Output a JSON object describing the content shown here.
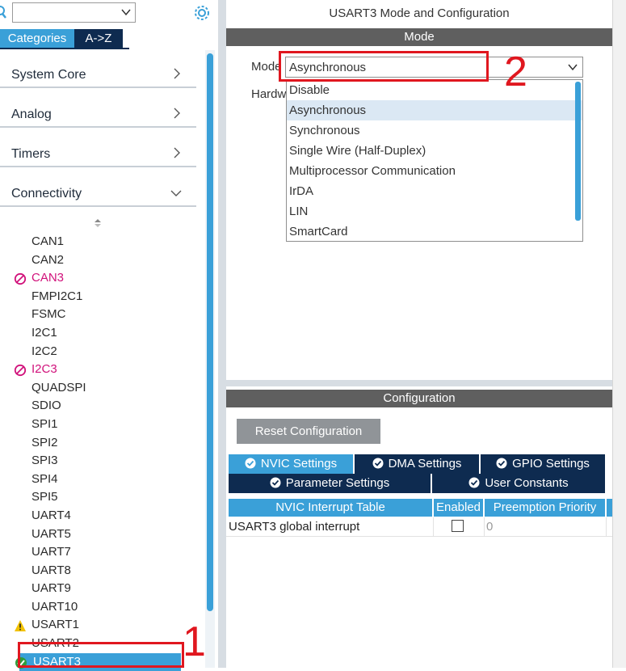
{
  "left_panel": {
    "tabs": [
      {
        "label": "Categories"
      },
      {
        "label": "A->Z"
      }
    ],
    "categories": [
      {
        "label": "System Core",
        "state": "collapsed"
      },
      {
        "label": "Analog",
        "state": "collapsed"
      },
      {
        "label": "Timers",
        "state": "collapsed"
      },
      {
        "label": "Connectivity",
        "state": "expanded"
      }
    ],
    "peripherals": [
      {
        "label": "CAN1",
        "status": "none"
      },
      {
        "label": "CAN2",
        "status": "none"
      },
      {
        "label": "CAN3",
        "status": "unavailable"
      },
      {
        "label": "FMPI2C1",
        "status": "none"
      },
      {
        "label": "FSMC",
        "status": "none"
      },
      {
        "label": "I2C1",
        "status": "none"
      },
      {
        "label": "I2C2",
        "status": "none"
      },
      {
        "label": "I2C3",
        "status": "unavailable"
      },
      {
        "label": "QUADSPI",
        "status": "none"
      },
      {
        "label": "SDIO",
        "status": "none"
      },
      {
        "label": "SPI1",
        "status": "none"
      },
      {
        "label": "SPI2",
        "status": "none"
      },
      {
        "label": "SPI3",
        "status": "none"
      },
      {
        "label": "SPI4",
        "status": "none"
      },
      {
        "label": "SPI5",
        "status": "none"
      },
      {
        "label": "UART4",
        "status": "none"
      },
      {
        "label": "UART5",
        "status": "none"
      },
      {
        "label": "UART7",
        "status": "none"
      },
      {
        "label": "UART8",
        "status": "none"
      },
      {
        "label": "UART9",
        "status": "none"
      },
      {
        "label": "UART10",
        "status": "none"
      },
      {
        "label": "USART1",
        "status": "warning"
      },
      {
        "label": "USART2",
        "status": "none"
      },
      {
        "label": "USART3",
        "status": "configured",
        "selected": true
      }
    ]
  },
  "right_panel": {
    "title": "USART3 Mode and Configuration",
    "mode_section": {
      "header": "Mode",
      "mode_label": "Mode",
      "mode_value": "Asynchronous",
      "hardware_label": "Hardw",
      "dropdown_options": [
        "Disable",
        "Asynchronous",
        "Synchronous",
        "Single Wire (Half-Duplex)",
        "Multiprocessor Communication",
        "IrDA",
        "LIN",
        "SmartCard"
      ],
      "highlighted_option": "Asynchronous"
    },
    "config_section": {
      "header": "Configuration",
      "reset_button": "Reset Configuration",
      "tabs_row1": [
        "NVIC Settings",
        "DMA Settings",
        "GPIO Settings"
      ],
      "tabs_row2": [
        "Parameter Settings",
        "User Constants"
      ],
      "active_tab": "NVIC Settings",
      "table": {
        "headers": [
          "NVIC Interrupt Table",
          "Enabled",
          "Preemption Priority"
        ],
        "rows": [
          {
            "name": "USART3 global interrupt",
            "enabled": false,
            "priority": "0"
          }
        ]
      }
    }
  },
  "annotations": [
    {
      "label": "1"
    },
    {
      "label": "2"
    }
  ],
  "colors": {
    "accent": "#3aa0d8",
    "dark_navy": "#0e2b50",
    "section_header": "#5f5f5f",
    "disabled_text": "#d1127b",
    "annotation_red": "#e0171f"
  }
}
